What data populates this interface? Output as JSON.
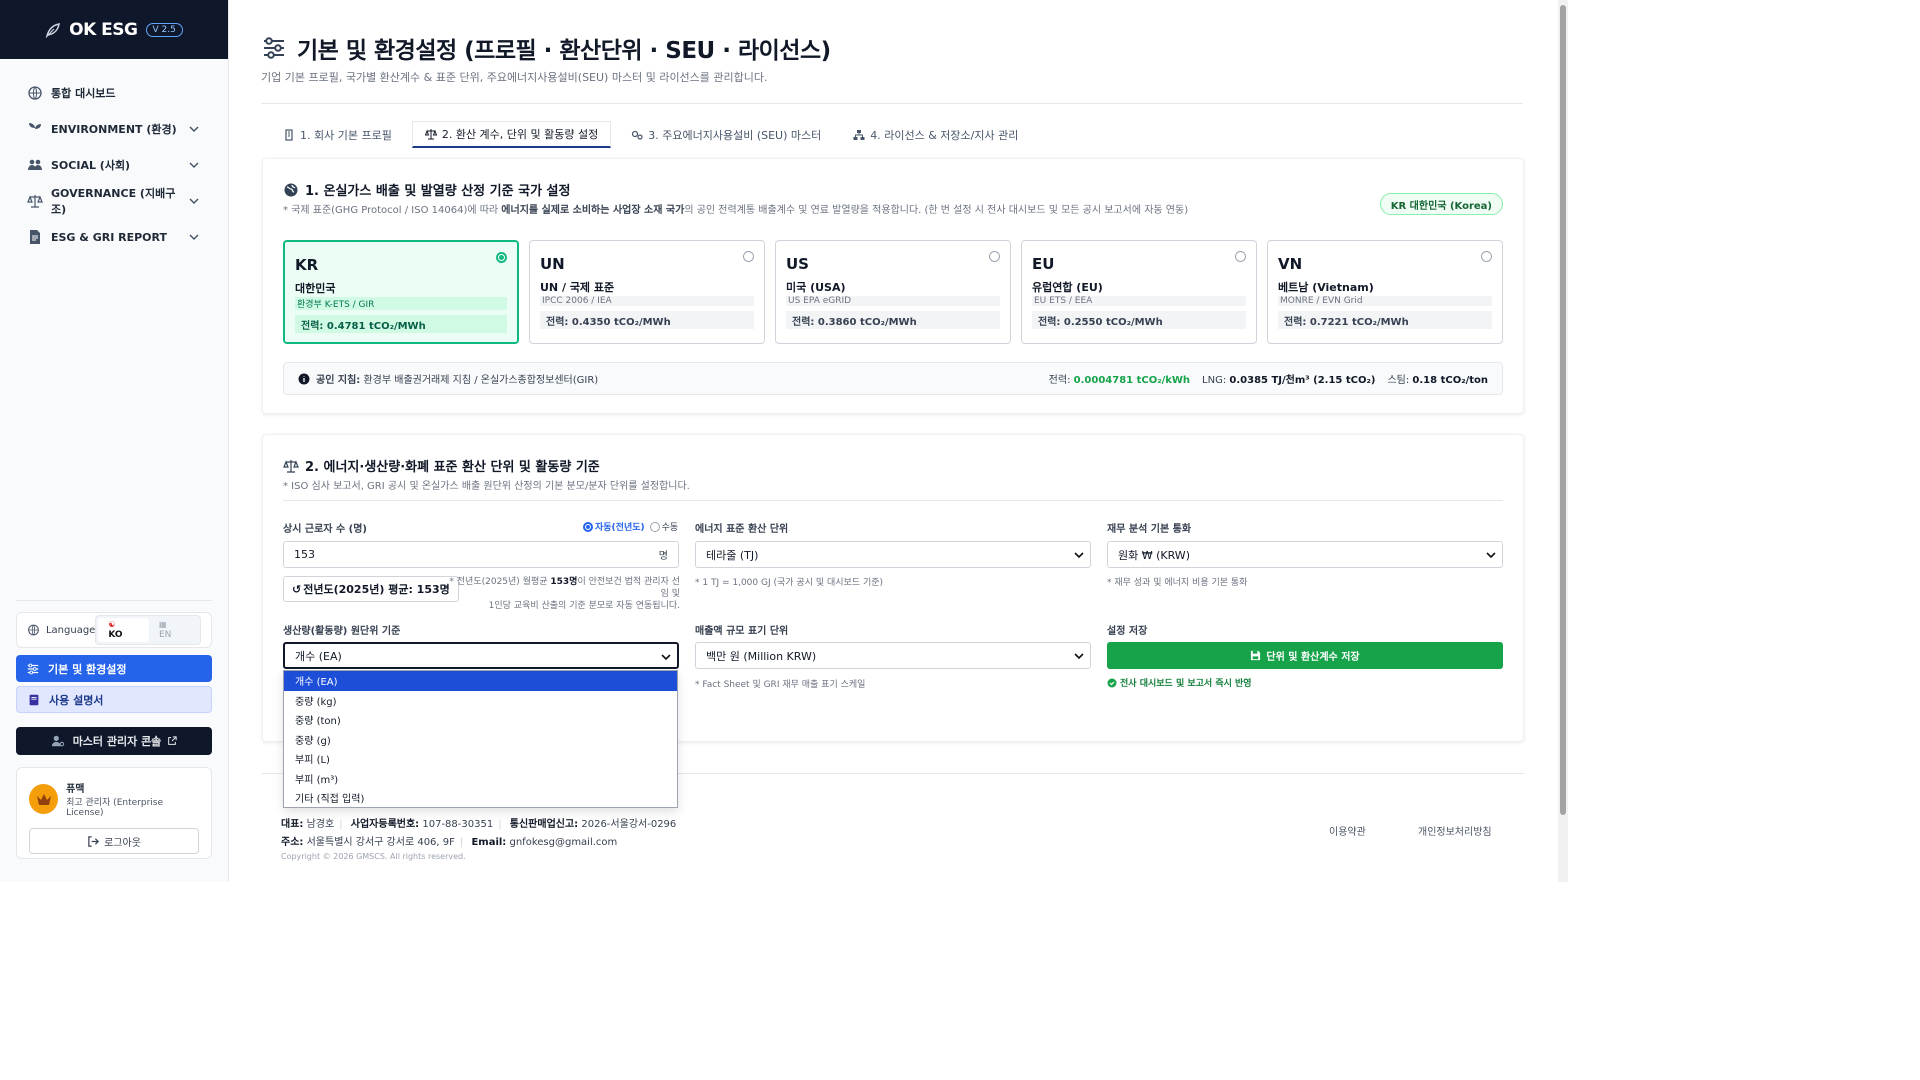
{
  "app": {
    "logo": "OK ESG",
    "version": "V 2.5"
  },
  "sidebar": {
    "items": [
      {
        "label": "통합 대시보드"
      },
      {
        "label": "ENVIRONMENT (환경)"
      },
      {
        "label": "SOCIAL (사회)"
      },
      {
        "label": "GOVERNANCE (지배구조)"
      },
      {
        "label": "ESG & GRI REPORT"
      }
    ],
    "language": {
      "label": "Language",
      "ko": "KO",
      "en": "EN"
    },
    "settings_label": "기본 및 환경설정",
    "manual_label": "사용 설명서",
    "master_label": "마스터 관리자 콘솔",
    "user": {
      "name": "퓨맥",
      "role": "최고 관리자 (Enterprise License)"
    },
    "logout_label": "로그아웃"
  },
  "page": {
    "title": "기본 및 환경설정 (프로필 · 환산단위 · SEU · 라이선스)",
    "subtitle": "기업 기본 프로필, 국가별 환산계수 & 표준 단위, 주요에너지사용설비(SEU) 마스터 및 라이선스를 관리합니다."
  },
  "tabs": [
    {
      "label": "1. 회사 기본 프로필",
      "active": false
    },
    {
      "label": "2. 환산 계수, 단위 및 활동량 설정",
      "active": true
    },
    {
      "label": "3. 주요에너지사용설비 (SEU) 마스터",
      "active": false
    },
    {
      "label": "4. 라이선스 & 저장소/지사 관리",
      "active": false
    }
  ],
  "section1": {
    "title": "1. 온실가스 배출 및 발열량 산정 기준 국가 설정",
    "desc_pre": "* 국제 표준(GHG Protocol / ISO 14064)에 따라 ",
    "desc_bold": "에너지를 실제로 소비하는 사업장 소재 국가",
    "desc_post": "의 공인 전력계통 배출계수 및 연료 발열량을 적용합니다. (한 번 설정 시 전사 대시보드 및 모든 공시 보고서에 자동 연동)",
    "badge": "KR 대한민국 (Korea)",
    "countries": [
      {
        "code": "KR",
        "name": "대한민국",
        "source": "환경부 K-ETS / GIR",
        "factor": "전력: 0.4781 tCO₂/MWh",
        "selected": true
      },
      {
        "code": "UN",
        "name": "UN / 국제 표준",
        "source": "IPCC 2006 / IEA",
        "factor": "전력: 0.4350 tCO₂/MWh",
        "selected": false
      },
      {
        "code": "US",
        "name": "미국 (USA)",
        "source": "US EPA eGRID",
        "factor": "전력: 0.3860 tCO₂/MWh",
        "selected": false
      },
      {
        "code": "EU",
        "name": "유럽연합 (EU)",
        "source": "EU ETS / EEA",
        "factor": "전력: 0.2550 tCO₂/MWh",
        "selected": false
      },
      {
        "code": "VN",
        "name": "베트남 (Vietnam)",
        "source": "MONRE / EVN Grid",
        "factor": "전력: 0.7221 tCO₂/MWh",
        "selected": false
      }
    ],
    "guide": {
      "label": "공인 지침:",
      "text": "환경부 배출권거래제 지침 / 온실가스종합정보센터(GIR)",
      "power_label": "전력:",
      "power_value": "0.0004781 tCO₂/kWh",
      "lng_label": "LNG:",
      "lng_value": "0.0385 TJ/천m³ (2.15 tCO₂)",
      "steam_label": "스팀:",
      "steam_value": "0.18 tCO₂/ton"
    }
  },
  "section2": {
    "title": "2. 에너지·생산량·화폐 표준 환산 단위 및 활동량 기준",
    "desc": "* ISO 심사 보고서, GRI 공시 및 온실가스 배출 원단위 산정의 기본 분모/분자 단위를 설정합니다.",
    "workers": {
      "label": "상시 근로자 수 (명)",
      "auto_label": "자동(전년도)",
      "manual_label": "수동",
      "value": "153",
      "unit": "명",
      "avg_label": "전년도(2025년) 평균: 153명",
      "note_line1_pre": "* 전년도(2025년) 월평균 ",
      "note_line1_bold": "153명",
      "note_line1_post": "이 안전보건 법적 관리자 선임 및",
      "note_line2": "1인당 교육비 산출의 기준 분모로 자동 연동됩니다."
    },
    "energy_unit": {
      "label": "에너지 표준 환산 단위",
      "value": "테라줄 (TJ)",
      "hint": "* 1 TJ = 1,000 GJ (국가 공시 및 대시보드 기준)"
    },
    "currency": {
      "label": "재무 분석 기본 통화",
      "value": "원화 ₩ (KRW)",
      "hint": "* 재무 성과 및 에너지 비용 기본 통화"
    },
    "production": {
      "label": "생산량(활동량) 원단위 기준",
      "value": "개수 (EA)",
      "options": [
        "개수 (EA)",
        "중량 (kg)",
        "중량 (ton)",
        "중량 (g)",
        "부피 (L)",
        "부피 (m³)",
        "기타 (직접 입력)"
      ]
    },
    "revenue": {
      "label": "매출액 규모 표기 단위",
      "value": "백만 원 (Million KRW)",
      "hint": "* Fact Sheet 및 GRI 재무 매출 표기 스케일"
    },
    "save": {
      "label": "설정 저장",
      "button": "단위 및 환산계수 저장",
      "note": "전사 대시보드 및 보고서 즉시 반영"
    }
  },
  "footer": {
    "rep_label": "대표:",
    "rep": "남경호",
    "biz_label": "사업자등록번호:",
    "biz": "107-88-30351",
    "sales_label": "통신판매업신고:",
    "sales": "2026-서울강서-0296",
    "addr_label": "주소:",
    "addr": "서울특별시 강서구 강서로 406, 9F",
    "email_label": "Email:",
    "email": "gnfokesg@gmail.com",
    "copyright": "Copyright © 2026 GMSCS. All rights reserved.",
    "terms": "이용약관",
    "privacy": "개인정보처리방침"
  },
  "colors": {
    "primary": "#2563eb",
    "success": "#16a34a",
    "sidebar_dark": "#0f172a"
  }
}
